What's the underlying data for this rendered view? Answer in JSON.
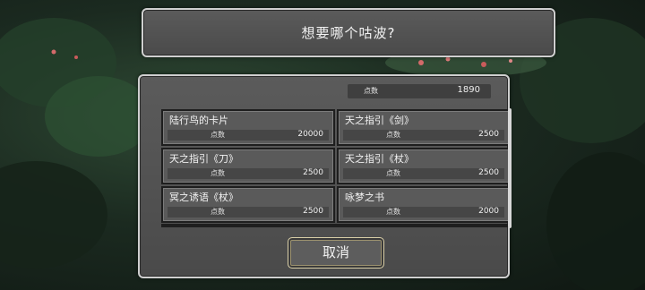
{
  "dialog": {
    "title": "想要哪个咕波?"
  },
  "points": {
    "label": "点数",
    "value": "1890"
  },
  "items": [
    {
      "name": "陆行鸟的卡片",
      "label": "点数",
      "cost": "20000"
    },
    {
      "name": "天之指引《剑》",
      "label": "点数",
      "cost": "2500"
    },
    {
      "name": "天之指引《刀》",
      "label": "点数",
      "cost": "2500"
    },
    {
      "name": "天之指引《杖》",
      "label": "点数",
      "cost": "2500"
    },
    {
      "name": "冥之诱语《杖》",
      "label": "点数",
      "cost": "2500"
    },
    {
      "name": "咏梦之书",
      "label": "点数",
      "cost": "2000"
    }
  ],
  "buttons": {
    "cancel": "取消"
  },
  "colors": {
    "panel": "#4f4f4f",
    "border": "#cfcfcf",
    "text": "#f2f2f2",
    "button_border": "#d9cfa8"
  }
}
